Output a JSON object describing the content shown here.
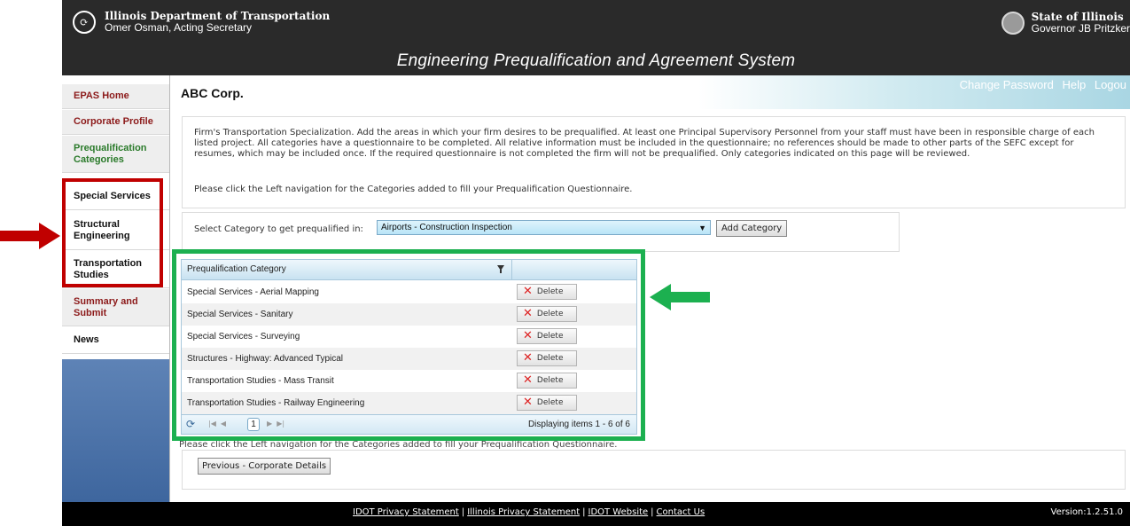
{
  "header": {
    "agency_title": "Illinois Department of Transportation",
    "agency_subtitle": "Omer Osman, Acting Secretary",
    "state_title": "State of Illinois",
    "state_subtitle": "Governor JB Pritzker",
    "system_title": "Engineering Prequalification and Agreement System"
  },
  "top_links": {
    "change_password": "Change Password",
    "help": "Help",
    "logout": "Logou"
  },
  "sidebar": {
    "items": [
      {
        "label": "EPAS Home"
      },
      {
        "label": "Corporate Profile"
      },
      {
        "label": "Prequalification Categories"
      },
      {
        "label": "Special Services"
      },
      {
        "label": "Structural Engineering"
      },
      {
        "label": "Transportation Studies"
      },
      {
        "label": "Summary and Submit"
      },
      {
        "label": "News"
      }
    ]
  },
  "main": {
    "firm_name": "ABC Corp.",
    "intro_text": "Firm's Transportation Specialization. Add the areas in which your firm desires to be prequalified. At least one Principal Supervisory Personnel from your staff must have been in responsible charge of each listed project. All categories have a questionnaire to be completed. All relative information must be included in the questionnaire; no references should be made to other parts of the SEFC except for resumes, which may be included once. If the required questionnaire is not completed the firm will not be prequalified. Only categories indicated on this page will be reviewed.",
    "intro_instruction": "Please click the Left navigation for the Categories added to fill your Prequalification Questionnaire.",
    "select_label": "Select Category to get prequalified in:",
    "select_value": "Airports - Construction Inspection",
    "add_button": "Add Category",
    "grid": {
      "column_header": "Prequalification Category",
      "delete_label": "Delete",
      "rows": [
        {
          "name": "Special Services - Aerial Mapping"
        },
        {
          "name": "Special Services - Sanitary"
        },
        {
          "name": "Special Services - Surveying"
        },
        {
          "name": "Structures - Highway: Advanced Typical"
        },
        {
          "name": "Transportation Studies - Mass Transit"
        },
        {
          "name": "Transportation Studies - Railway Engineering"
        }
      ],
      "current_page": "1",
      "pager_info": "Displaying items 1 - 6 of 6"
    },
    "bottom_instruction": "Please click the Left navigation for the Categories added to fill your Prequalification Questionnaire.",
    "prev_button": "Previous - Corporate Details"
  },
  "footer": {
    "links": [
      "IDOT Privacy Statement",
      "Illinois Privacy Statement",
      "IDOT Website",
      "Contact Us"
    ],
    "separator": "|",
    "version": "Version:1.2.51.0"
  },
  "colors": {
    "annotation_red": "#c00000",
    "annotation_green": "#1cb050",
    "banner": "#2a2a2a",
    "nav_red": "#8c1a1a",
    "nav_green": "#2a7a2a"
  }
}
